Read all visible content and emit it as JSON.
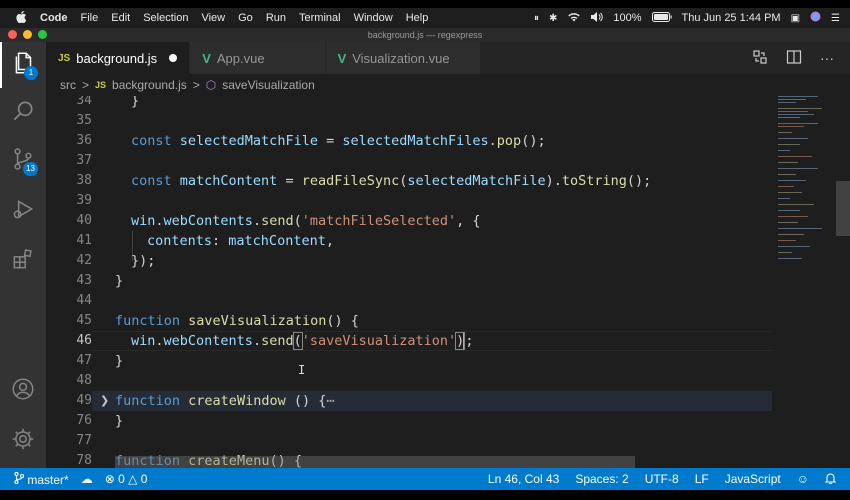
{
  "menubar": {
    "apple": "",
    "items": [
      "Code",
      "File",
      "Edit",
      "Selection",
      "View",
      "Go",
      "Run",
      "Terminal",
      "Window",
      "Help"
    ],
    "battery": "100%",
    "datetime": "Thu Jun 25  1:44 PM"
  },
  "window": {
    "title": "background.js — regexpress"
  },
  "activity": {
    "explorer_badge": "1",
    "scm_badge": "13"
  },
  "tabs": [
    {
      "label": "background.js",
      "type": "js",
      "type_label": "JS",
      "active": true,
      "modified": true
    },
    {
      "label": "App.vue",
      "type": "vue",
      "type_label": "V",
      "active": false
    },
    {
      "label": "Visualization.vue",
      "type": "vue",
      "type_label": "V",
      "active": false
    }
  ],
  "breadcrumb": {
    "folder": "src",
    "file_icon": "JS",
    "file": "background.js",
    "separator": ">",
    "symbol": "saveVisualization"
  },
  "editor": {
    "line_numbers": [
      "34",
      "35",
      "36",
      "37",
      "38",
      "39",
      "40",
      "41",
      "42",
      "43",
      "44",
      "45",
      "46",
      "47",
      "48",
      "49",
      "76",
      "77",
      "78"
    ],
    "lines": {
      "l34": "}",
      "l36a": "const",
      "l36b": "selectedMatchFile",
      "l36c": " = ",
      "l36d": "selectedMatchFiles",
      "l36e": ".",
      "l36f": "pop",
      "l36g": "();",
      "l38a": "const",
      "l38b": "matchContent",
      "l38c": " = ",
      "l38d": "readFileSync",
      "l38e": "(",
      "l38f": "selectedMatchFile",
      "l38g": ").",
      "l38h": "toString",
      "l38i": "();",
      "l40a": "win",
      "l40b": ".",
      "l40c": "webContents",
      "l40d": ".",
      "l40e": "send",
      "l40f": "(",
      "l40g": "'matchFileSelected'",
      "l40h": ", {",
      "l41a": "contents",
      "l41b": ": ",
      "l41c": "matchContent",
      "l41d": ",",
      "l42": "});",
      "l43": "}",
      "l45a": "function",
      "l45b": "saveVisualization",
      "l45c": "() {",
      "l46a": "win",
      "l46b": ".",
      "l46c": "webContents",
      "l46d": ".",
      "l46e": "send",
      "l46f": "(",
      "l46g": "'saveVisualization'",
      "l46h": ")",
      "l46i": ";",
      "l47": "}",
      "l49a": "function",
      "l49b": "createWindow",
      "l49c": " () {",
      "l49d": "⋯",
      "l76": "}",
      "l78a": "function",
      "l78b": "createMenu",
      "l78c": "() {"
    }
  },
  "statusbar": {
    "branch": "master*",
    "errors": "0",
    "warnings": "0",
    "position": "Ln 46, Col 43",
    "spaces": "Spaces: 2",
    "encoding": "UTF-8",
    "eol": "LF",
    "language": "JavaScript"
  },
  "colors": {
    "statusbar": "#007acc",
    "editor_bg": "#1e1e1e",
    "keyword": "#569cd6",
    "function": "#dcdcaa",
    "variable": "#9cdcfe",
    "string": "#ce9178"
  }
}
